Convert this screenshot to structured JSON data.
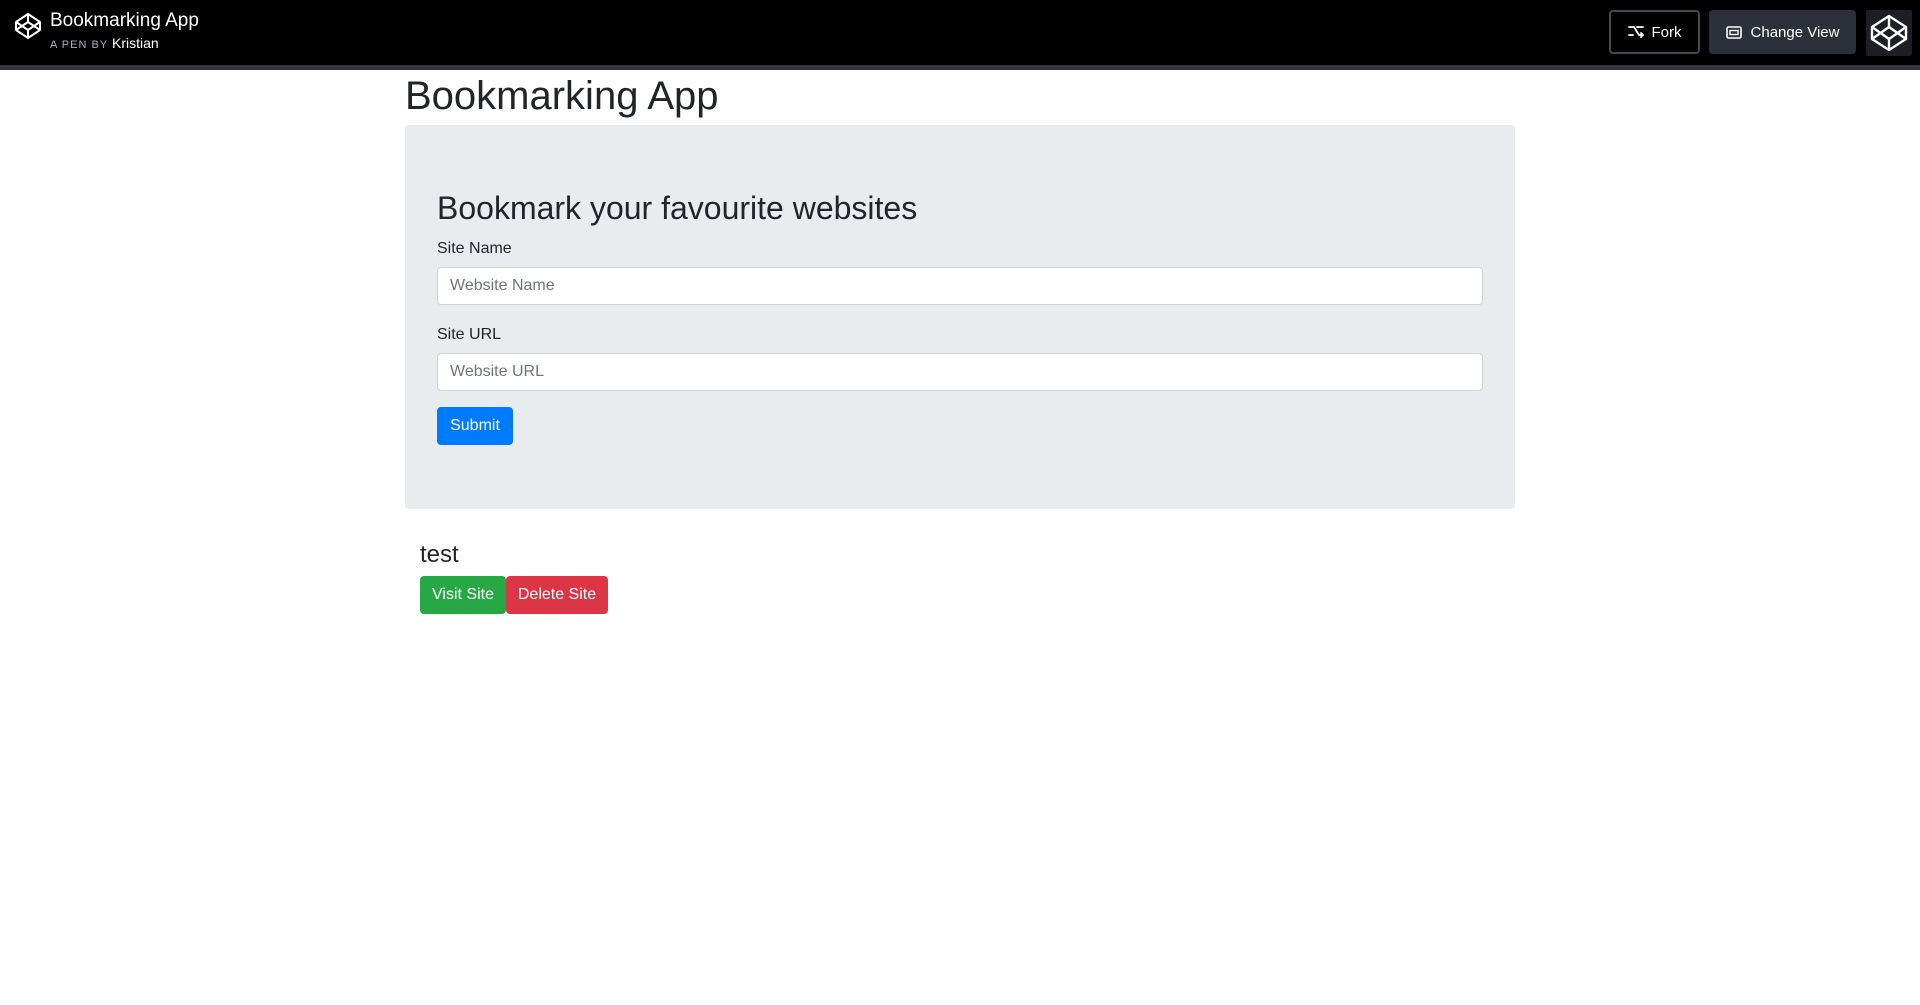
{
  "topbar": {
    "pen_title": "Bookmarking App",
    "pen_by_prefix": "A PEN BY",
    "author": "Kristian",
    "fork_label": "Fork",
    "change_view_label": "Change View",
    "logo_icon": "codepen-logo-icon"
  },
  "page": {
    "title": "Bookmarking App"
  },
  "form": {
    "heading": "Bookmark your favourite websites",
    "site_name_label": "Site Name",
    "site_name_placeholder": "Website Name",
    "site_name_value": "",
    "site_url_label": "Site URL",
    "site_url_placeholder": "Website URL",
    "site_url_value": "",
    "submit_label": "Submit"
  },
  "bookmarks": [
    {
      "name": "test",
      "visit_label": "Visit Site",
      "delete_label": "Delete Site"
    }
  ],
  "colors": {
    "primary": "#007bff",
    "success": "#28a745",
    "danger": "#dc3545",
    "jumbotron_bg": "#e9ecef",
    "topbar_bg": "#000000"
  }
}
